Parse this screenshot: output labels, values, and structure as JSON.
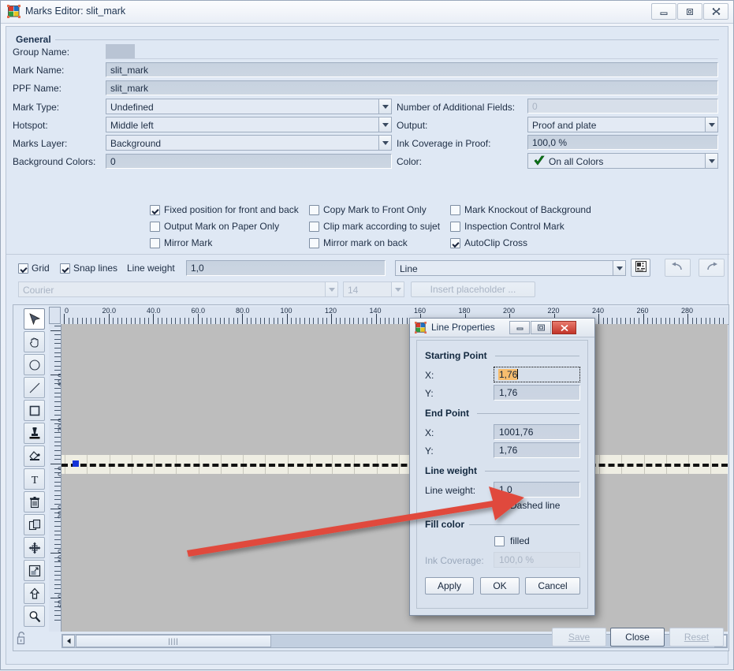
{
  "window": {
    "title": "Marks Editor: slit_mark",
    "icon": "marks-editor-icon",
    "buttons": {
      "minimize": "minimize-icon",
      "maximize": "maximize-icon",
      "close": "close-icon"
    }
  },
  "general": {
    "legend": "General",
    "fields": [
      {
        "label": "Group Name:",
        "value": "",
        "type": "text",
        "name": "group-name"
      },
      {
        "label": "Mark Name:",
        "value": "slit_mark",
        "type": "text",
        "name": "mark-name"
      },
      {
        "label": "PPF Name:",
        "value": "slit_mark",
        "type": "text",
        "name": "ppf-name"
      },
      {
        "label": "Mark Type:",
        "value": "Undefined",
        "type": "combo",
        "name": "mark-type"
      },
      {
        "label": "Hotspot:",
        "value": "Middle left",
        "type": "combo",
        "name": "hotspot"
      },
      {
        "label": "Marks Layer:",
        "value": "Background",
        "type": "combo",
        "name": "marks-layer"
      },
      {
        "label": "Background Colors:",
        "value": "0",
        "type": "text",
        "name": "background-colors"
      }
    ],
    "right_fields": [
      {
        "label": "Number of Additional Fields:",
        "value": "0",
        "type": "text-disabled",
        "name": "additional-fields"
      },
      {
        "label": "Output:",
        "value": "Proof and plate",
        "type": "combo",
        "name": "output"
      },
      {
        "label": "Ink Coverage in Proof:",
        "value": "100,0 %",
        "type": "text",
        "name": "ink-coverage-proof"
      },
      {
        "label": "Color:",
        "value": "On all Colors",
        "type": "combo-check",
        "name": "color"
      }
    ],
    "checkboxes": [
      {
        "label": "Fixed position for front and back",
        "checked": true,
        "name": "fixed-position"
      },
      {
        "label": "Output Mark on Paper Only",
        "checked": false,
        "name": "output-paper-only"
      },
      {
        "label": "Mirror Mark",
        "checked": false,
        "name": "mirror-mark"
      },
      {
        "label": "Copy Mark to Front Only",
        "checked": false,
        "name": "copy-mark-front-only"
      },
      {
        "label": "Clip mark according to sujet",
        "checked": false,
        "name": "clip-mark-sujet"
      },
      {
        "label": "Mirror mark on back",
        "checked": false,
        "name": "mirror-mark-back"
      },
      {
        "label": "Mark Knockout of Background",
        "checked": false,
        "name": "mark-knockout"
      },
      {
        "label": "Inspection Control Mark",
        "checked": false,
        "name": "inspection-control-mark"
      },
      {
        "label": "AutoClip Cross",
        "checked": true,
        "name": "autoclip-cross"
      }
    ]
  },
  "toolbar": {
    "grid": {
      "label": "Grid",
      "checked": true
    },
    "snap_lines": {
      "label": "Snap lines",
      "checked": true
    },
    "line_weight_label": "Line weight",
    "line_weight_value": "1,0",
    "shape_value": "Line",
    "properties_icon": "properties-icon",
    "undo_icon": "undo-icon",
    "redo_icon": "redo-icon",
    "font_value": "Courier",
    "font_size_value": "14",
    "insert_placeholder_label": "Insert placeholder ..."
  },
  "tools": [
    {
      "name": "select-tool",
      "icon": "arrow-cursor-icon",
      "selected": true
    },
    {
      "name": "pan-tool",
      "icon": "hand-icon",
      "selected": false
    },
    {
      "name": "ellipse-tool",
      "icon": "circle-icon",
      "selected": false
    },
    {
      "name": "line-tool",
      "icon": "line-icon",
      "selected": false
    },
    {
      "name": "rect-tool",
      "icon": "rectangle-icon",
      "selected": false
    },
    {
      "name": "stamp-tool",
      "icon": "stamp-icon",
      "selected": false
    },
    {
      "name": "fill-tool",
      "icon": "paint-bucket-icon",
      "selected": false
    },
    {
      "name": "text-tool",
      "icon": "text-t-icon",
      "selected": false
    },
    {
      "name": "delete-tool",
      "icon": "trash-icon",
      "selected": false
    },
    {
      "name": "duplicate-tool",
      "icon": "copy-icon",
      "selected": false
    },
    {
      "name": "move-tool",
      "icon": "move-cross-icon",
      "selected": false
    },
    {
      "name": "resize-tool",
      "icon": "resize-icon",
      "selected": false
    },
    {
      "name": "bring-front-tool",
      "icon": "up-arrow-icon",
      "selected": false
    },
    {
      "name": "zoom-tool",
      "icon": "magnifier-icon",
      "selected": false
    }
  ],
  "rulers": {
    "horizontal_labels": [
      "0",
      "20.0",
      "40.0",
      "60.0",
      "80.0",
      "100",
      "120",
      "140",
      "160",
      "180",
      "200",
      "220",
      "240",
      "260",
      "280"
    ],
    "vertical_labels": [
      "60.0",
      "40.0",
      "20.0",
      "0,0",
      "-20.0",
      "-40.0",
      "-60.0"
    ]
  },
  "canvas": {
    "mark_name": "dashed-line-mark"
  },
  "scrollbar": {
    "left_arrow": "scroll-left-icon",
    "right_arrow": "scroll-right-icon",
    "grip": "||||"
  },
  "footer": {
    "lock_icon": "lock-icon",
    "save": {
      "label": "Save",
      "disabled": true
    },
    "close": {
      "label": "Close",
      "disabled": false
    },
    "reset": {
      "label": "Reset",
      "disabled": true
    }
  },
  "dialog": {
    "title": "Line Properties",
    "icon": "marks-editor-icon",
    "buttons": {
      "minimize": "minimize-icon",
      "maximize": "maximize-icon",
      "close": "close-icon"
    },
    "starting_point": {
      "legend": "Starting Point",
      "x": {
        "label": "X:",
        "value": "1,76",
        "focused": true
      },
      "y": {
        "label": "Y:",
        "value": "1,76",
        "focused": false
      }
    },
    "end_point": {
      "legend": "End Point",
      "x": {
        "label": "X:",
        "value": "1001,76"
      },
      "y": {
        "label": "Y:",
        "value": "1,76"
      }
    },
    "line_weight": {
      "legend": "Line weight",
      "label": "Line weight:",
      "value": "1,0",
      "dashed": {
        "label": "Dashed line",
        "checked": true
      }
    },
    "fill_color": {
      "legend": "Fill color",
      "filled": {
        "label": "filled",
        "checked": false
      },
      "ink_coverage": {
        "label": "Ink Coverage:",
        "value": "100,0 %",
        "disabled": true
      }
    },
    "apply": "Apply",
    "ok": "OK",
    "cancel": "Cancel"
  },
  "annotation": {
    "arrow_color": "#e04a3c",
    "arrow_target": "dashed-line-checkbox"
  }
}
